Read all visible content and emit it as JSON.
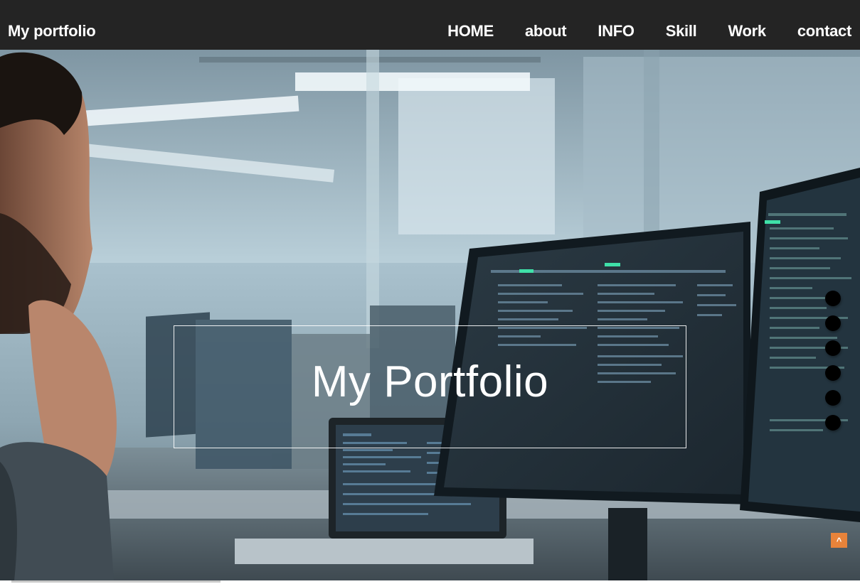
{
  "header": {
    "brand": "My portfolio",
    "nav": [
      "HOME",
      "about",
      "INFO",
      "Skill",
      "Work",
      "contact"
    ]
  },
  "hero": {
    "title": "My Portfolio",
    "background_description_icon": "office-photo",
    "section_dots_count": 6,
    "back_to_top_label": "^"
  },
  "colors": {
    "header_bg": "#242424",
    "accent": "#e8833a",
    "text": "#ffffff"
  }
}
